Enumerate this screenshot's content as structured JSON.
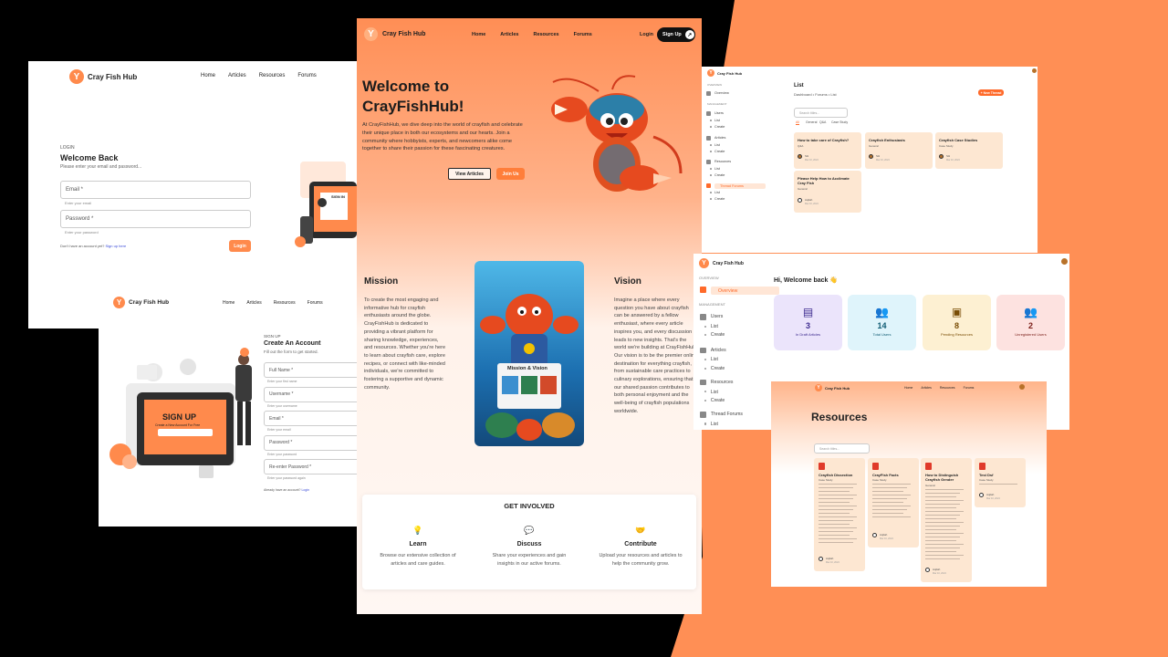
{
  "brand": {
    "name": "Cray Fish Hub",
    "logo_letter": "Y"
  },
  "nav": {
    "home": "Home",
    "articles": "Articles",
    "resources": "Resources",
    "forums": "Forums"
  },
  "login_panel": {
    "kicker": "LOGIN",
    "title": "Welcome Back",
    "subtitle": "Please enter your email and password...",
    "email_label": "Email *",
    "email_helper": "Enter your email",
    "password_label": "Password *",
    "password_helper": "Enter your password",
    "signup_prompt": "Don't have an account yet?",
    "signup_link": "Sign up here",
    "login_button": "Login",
    "illustration_text": "SIGN IN"
  },
  "signup_panel": {
    "kicker": "SIGN UP",
    "title": "Create An Account",
    "subtitle": "Fill out the form to get started.",
    "fields": [
      {
        "label": "Full Name *",
        "helper": "Enter your first name"
      },
      {
        "label": "Username *",
        "helper": "Enter your username"
      },
      {
        "label": "Email *",
        "helper": "Enter your email"
      },
      {
        "label": "Password *",
        "helper": "Enter your password"
      },
      {
        "label": "Re-enter Password *",
        "helper": "Enter your password again"
      }
    ],
    "login_prompt": "Already have an account?",
    "login_link": "Login",
    "illustration_text": "SIGN UP",
    "illustration_subtext": "Create a New Account For Free"
  },
  "landing": {
    "brand": "Cray Fish Hub",
    "login": "Login",
    "signup": "Sign Up",
    "hero_title_1": "Welcome to",
    "hero_title_2": "CrayFishHub!",
    "hero_text": "At CrayFishHub, we dive deep into the world of crayfish and celebrate their unique place in both our ecosystems and our hearts. Join a community where hobbyists, experts, and newcomers alike come together to share their passion for these fascinating creatures.",
    "view_articles": "View Articles",
    "join_us": "Join Us",
    "mission_title": "Mission",
    "mission_text": "To create the most engaging and informative hub for crayfish enthusiasts around the globe. CrayFishHub is dedicated to providing a vibrant platform for sharing knowledge, experiences, and resources. Whether you're here to learn about crayfish care, explore recipes, or connect with like-minded individuals, we're committed to fostering a supportive and dynamic community.",
    "mission_image_text": "Mission & Vision",
    "vision_title": "Vision",
    "vision_text": "Imagine a place where every question you have about crayfish can be answered by a fellow enthusiast, where every article inspires you, and every discussion leads to new insights. That's the world we're building at CrayFishHub. Our vision is to be the premier online destination for everything crayfish, from sustainable care practices to culinary explorations, ensuring that our shared passion contributes to both personal enjoyment and the well-being of crayfish populations worldwide.",
    "get_involved": "GET INVOLVED",
    "involve_items": [
      {
        "title": "Learn",
        "text": "Browse our extensive collection of articles and care guides."
      },
      {
        "title": "Discuss",
        "text": "Share your experiences and gain insights in our active forums."
      },
      {
        "title": "Contribute",
        "text": "Upload your resources and articles to help the community grow."
      }
    ]
  },
  "forum_panel": {
    "brand": "Cray Fish Hub",
    "section_overview": "OVERVIEW",
    "section_management": "MANAGEMENT",
    "side_items": [
      "Overview",
      "Users",
      "List",
      "Create",
      "Articles",
      "List",
      "Create",
      "Resources",
      "List",
      "Create",
      "Thread Forums",
      "List",
      "Create"
    ],
    "page_title": "List",
    "breadcrumb": "Dashboard  •  Forums  •  List",
    "new_thread": "+ New Thread",
    "search_placeholder": "Search titles...",
    "tabs": [
      "All",
      "General",
      "Q&A",
      "Case Study"
    ],
    "threads": [
      {
        "title": "How to take care of Crayfish?",
        "tag": "Q&A",
        "author": "Siti",
        "date": "Mar 10, 2024"
      },
      {
        "title": "Crayfish Enthusiasts",
        "tag": "General",
        "author": "Siti",
        "date": "Mar 10, 2024"
      },
      {
        "title": "Crayfish Case Studies",
        "tag": "Case Study",
        "author": "Siti",
        "date": "Mar 10, 2024"
      },
      {
        "title": "Please Help How to Acclimate Cray Fish",
        "tag": "General",
        "author": "Aqilah",
        "date": "Mar 10, 2024"
      }
    ]
  },
  "dashboard_panel": {
    "brand": "Cray Fish Hub",
    "greeting": "Hi, Welcome back 👋",
    "section_overview": "OVERVIEW",
    "section_management": "MANAGEMENT",
    "side_items": [
      "Overview",
      "Users",
      "List",
      "Create",
      "Articles",
      "List",
      "Create",
      "Resources",
      "List",
      "Create",
      "Thread Forums",
      "List",
      "Create"
    ],
    "stats": [
      {
        "value": "3",
        "label": "In Draft Articles",
        "color": "#ebe4fb",
        "icon_color": "#3d2b8f"
      },
      {
        "value": "14",
        "label": "Total Users",
        "color": "#dff4fb",
        "icon_color": "#0f5b73"
      },
      {
        "value": "8",
        "label": "Pending Resources",
        "color": "#fdf0d2",
        "icon_color": "#7a4e06"
      },
      {
        "value": "2",
        "label": "Unregistered Users",
        "color": "#fde2e0",
        "icon_color": "#7a1e18"
      }
    ]
  },
  "resources_panel": {
    "brand": "Cray Fish Hub",
    "title": "Resources",
    "search_placeholder": "Search titles...",
    "cards": [
      {
        "title": "Crayfish Dissection",
        "tag": "Case Study",
        "author": "Aqilah",
        "date": "Mar 10, 2024"
      },
      {
        "title": "CrayFish Facts",
        "tag": "Case Study",
        "author": "Aqilah",
        "date": "Mar 10, 2024"
      },
      {
        "title": "How to Distinguish Crayfish Gender",
        "tag": "General",
        "author": "Aqilah",
        "date": "Mar 10, 2024"
      },
      {
        "title": "Test Dsf",
        "tag": "Case Study",
        "author": "Aqilah",
        "date": "Mar 10, 2024"
      }
    ]
  }
}
